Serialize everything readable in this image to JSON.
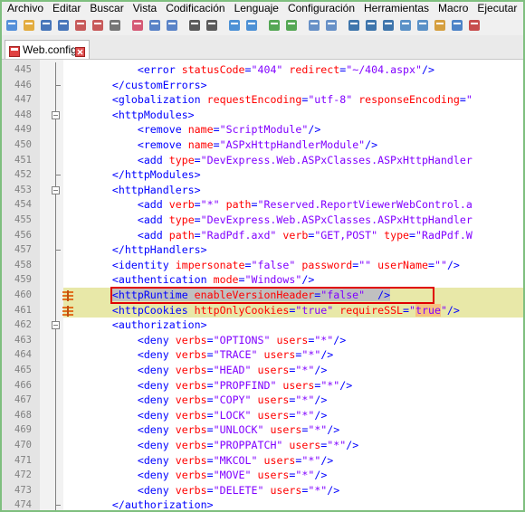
{
  "menu": [
    "Archivo",
    "Editar",
    "Buscar",
    "Vista",
    "Codificación",
    "Lenguaje",
    "Configuración",
    "Herramientas",
    "Macro",
    "Ejecutar"
  ],
  "toolbar_icons": [
    "new-file-icon",
    "open-file-icon",
    "save-icon",
    "save-all-icon",
    "close-icon",
    "close-all-icon",
    "print-icon",
    "cut-icon",
    "copy-icon",
    "paste-icon",
    "undo-icon",
    "redo-icon",
    "find-icon",
    "replace-icon",
    "zoom-in-icon",
    "zoom-out-icon",
    "sync-vertical-icon",
    "sync-horizontal-icon",
    "word-wrap-icon",
    "show-all-chars-icon",
    "indent-guide-icon",
    "doc-map-icon",
    "function-list-icon",
    "folder-workspace-icon",
    "monitor-icon",
    "record-macro-icon"
  ],
  "tab": {
    "label": "Web.config"
  },
  "lines": [
    {
      "n": "445",
      "html": "        <span class='tg'>&lt;error</span> <span class='at'>statusCode</span><span class='tg'>=</span><span class='vl'>\"404\"</span> <span class='at'>redirect</span><span class='tg'>=</span><span class='vl'>\"~/404.aspx\"</span><span class='tg'>/&gt;</span>"
    },
    {
      "n": "446",
      "html": "    <span class='tg'>&lt;/customErrors&gt;</span>"
    },
    {
      "n": "447",
      "html": "    <span class='tg'>&lt;globalization</span> <span class='at'>requestEncoding</span><span class='tg'>=</span><span class='vl'>\"utf-8\"</span> <span class='at'>responseEncoding</span><span class='tg'>=</span><span class='vl'>\"</span>"
    },
    {
      "n": "448",
      "html": "    <span class='tg'>&lt;httpModules&gt;</span>"
    },
    {
      "n": "449",
      "html": "        <span class='tg'>&lt;remove</span> <span class='at'>name</span><span class='tg'>=</span><span class='vl'>\"ScriptModule\"</span><span class='tg'>/&gt;</span>"
    },
    {
      "n": "450",
      "html": "        <span class='tg'>&lt;remove</span> <span class='at'>name</span><span class='tg'>=</span><span class='vl'>\"ASPxHttpHandlerModule\"</span><span class='tg'>/&gt;</span>"
    },
    {
      "n": "451",
      "html": "        <span class='tg'>&lt;add</span> <span class='at'>type</span><span class='tg'>=</span><span class='vl'>\"DevExpress.Web.ASPxClasses.ASPxHttpHandler</span>"
    },
    {
      "n": "452",
      "html": "    <span class='tg'>&lt;/httpModules&gt;</span>"
    },
    {
      "n": "453",
      "html": "    <span class='tg'>&lt;httpHandlers&gt;</span>"
    },
    {
      "n": "454",
      "html": "        <span class='tg'>&lt;add</span> <span class='at'>verb</span><span class='tg'>=</span><span class='vl'>\"*\"</span> <span class='at'>path</span><span class='tg'>=</span><span class='vl'>\"Reserved.ReportViewerWebControl.a</span>"
    },
    {
      "n": "455",
      "html": "        <span class='tg'>&lt;add</span> <span class='at'>type</span><span class='tg'>=</span><span class='vl'>\"DevExpress.Web.ASPxClasses.ASPxHttpHandler</span>"
    },
    {
      "n": "456",
      "html": "        <span class='tg'>&lt;add</span> <span class='at'>path</span><span class='tg'>=</span><span class='vl'>\"RadPdf.axd\"</span> <span class='at'>verb</span><span class='tg'>=</span><span class='vl'>\"GET,POST\"</span> <span class='at'>type</span><span class='tg'>=</span><span class='vl'>\"RadPdf.W</span>"
    },
    {
      "n": "457",
      "html": "    <span class='tg'>&lt;/httpHandlers&gt;</span>"
    },
    {
      "n": "458",
      "html": "    <span class='tg'>&lt;identity</span> <span class='at'>impersonate</span><span class='tg'>=</span><span class='vl'>\"false\"</span> <span class='at'>password</span><span class='tg'>=</span><span class='vl'>\"\"</span> <span class='at'>userName</span><span class='tg'>=</span><span class='vl'>\"\"</span><span class='tg'>/&gt;</span>"
    },
    {
      "n": "459",
      "html": "    <span class='tg'>&lt;authentication</span> <span class='at'>mode</span><span class='tg'>=</span><span class='vl'>\"Windows\"</span><span class='tg'>/&gt;</span>"
    },
    {
      "n": "460",
      "html": "    <span class='sel'><span class='tg'>&lt;httpRuntime</span> <span class='at'>enableVersionHeader</span><span class='tg'>=</span><span class='vl'>\"false\"</span>  <span class='tg'>/&gt;</span></span>"
    },
    {
      "n": "461",
      "html": "    <span class='tg'>&lt;httpCookies</span> <span class='at'>httpOnlyCookies</span><span class='tg'>=</span><span class='vl'>\"true\"</span> <span class='at'>requireSSL</span><span class='tg'>=</span><span class='vl'>\"<span style='background:#f5c080'>true</span>\"</span><span class='tg'>/&gt;</span>"
    },
    {
      "n": "462",
      "html": "    <span class='tg'>&lt;authorization&gt;</span>"
    },
    {
      "n": "463",
      "html": "        <span class='tg'>&lt;deny</span> <span class='at'>verbs</span><span class='tg'>=</span><span class='vl'>\"OPTIONS\"</span> <span class='at'>users</span><span class='tg'>=</span><span class='vl'>\"*\"</span><span class='tg'>/&gt;</span>"
    },
    {
      "n": "464",
      "html": "        <span class='tg'>&lt;deny</span> <span class='at'>verbs</span><span class='tg'>=</span><span class='vl'>\"TRACE\"</span> <span class='at'>users</span><span class='tg'>=</span><span class='vl'>\"*\"</span><span class='tg'>/&gt;</span>"
    },
    {
      "n": "465",
      "html": "        <span class='tg'>&lt;deny</span> <span class='at'>verbs</span><span class='tg'>=</span><span class='vl'>\"HEAD\"</span> <span class='at'>users</span><span class='tg'>=</span><span class='vl'>\"*\"</span><span class='tg'>/&gt;</span>"
    },
    {
      "n": "466",
      "html": "        <span class='tg'>&lt;deny</span> <span class='at'>verbs</span><span class='tg'>=</span><span class='vl'>\"PROPFIND\"</span> <span class='at'>users</span><span class='tg'>=</span><span class='vl'>\"*\"</span><span class='tg'>/&gt;</span>"
    },
    {
      "n": "467",
      "html": "        <span class='tg'>&lt;deny</span> <span class='at'>verbs</span><span class='tg'>=</span><span class='vl'>\"COPY\"</span> <span class='at'>users</span><span class='tg'>=</span><span class='vl'>\"*\"</span><span class='tg'>/&gt;</span>"
    },
    {
      "n": "468",
      "html": "        <span class='tg'>&lt;deny</span> <span class='at'>verbs</span><span class='tg'>=</span><span class='vl'>\"LOCK\"</span> <span class='at'>users</span><span class='tg'>=</span><span class='vl'>\"*\"</span><span class='tg'>/&gt;</span>"
    },
    {
      "n": "469",
      "html": "        <span class='tg'>&lt;deny</span> <span class='at'>verbs</span><span class='tg'>=</span><span class='vl'>\"UNLOCK\"</span> <span class='at'>users</span><span class='tg'>=</span><span class='vl'>\"*\"</span><span class='tg'>/&gt;</span>"
    },
    {
      "n": "470",
      "html": "        <span class='tg'>&lt;deny</span> <span class='at'>verbs</span><span class='tg'>=</span><span class='vl'>\"PROPPATCH\"</span> <span class='at'>users</span><span class='tg'>=</span><span class='vl'>\"*\"</span><span class='tg'>/&gt;</span>"
    },
    {
      "n": "471",
      "html": "        <span class='tg'>&lt;deny</span> <span class='at'>verbs</span><span class='tg'>=</span><span class='vl'>\"MKCOL\"</span> <span class='at'>users</span><span class='tg'>=</span><span class='vl'>\"*\"</span><span class='tg'>/&gt;</span>"
    },
    {
      "n": "472",
      "html": "        <span class='tg'>&lt;deny</span> <span class='at'>verbs</span><span class='tg'>=</span><span class='vl'>\"MOVE\"</span> <span class='at'>users</span><span class='tg'>=</span><span class='vl'>\"*\"</span><span class='tg'>/&gt;</span>"
    },
    {
      "n": "473",
      "html": "        <span class='tg'>&lt;deny</span> <span class='at'>verbs</span><span class='tg'>=</span><span class='vl'>\"DELETE\"</span> <span class='at'>users</span><span class='tg'>=</span><span class='vl'>\"*\"</span><span class='tg'>/&gt;</span>"
    },
    {
      "n": "474",
      "html": "    <span class='tg'>&lt;/authorization&gt;</span>"
    }
  ]
}
